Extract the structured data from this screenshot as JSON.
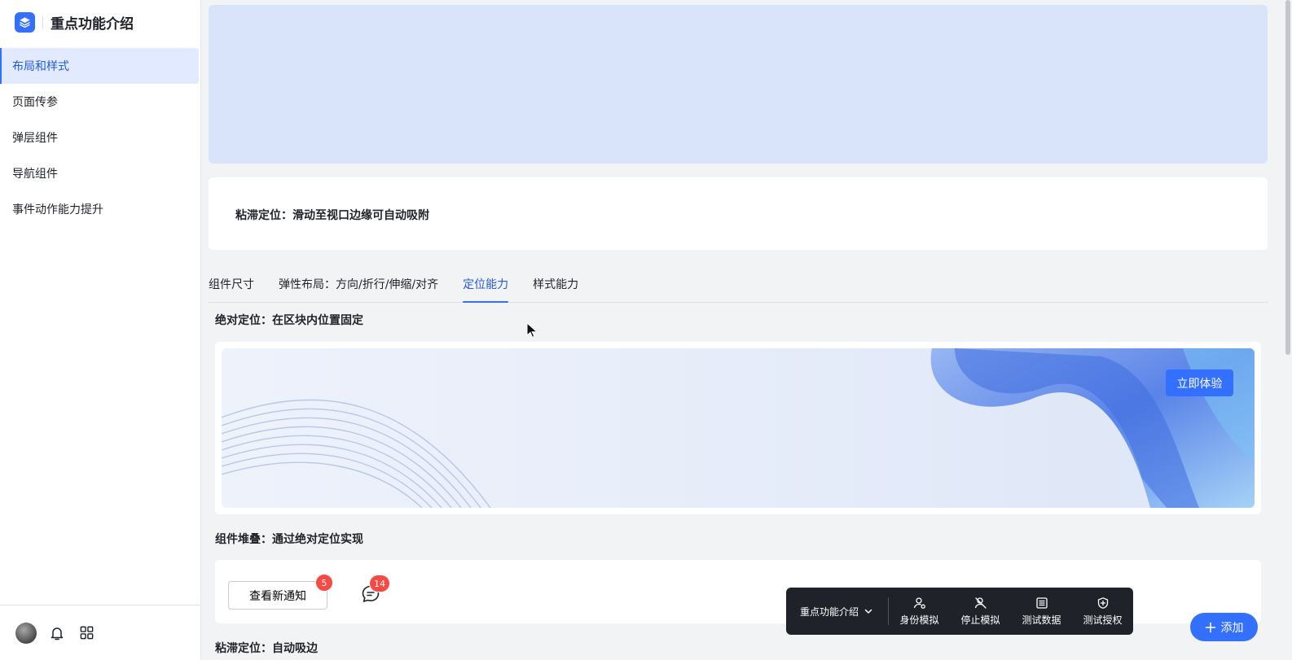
{
  "sidebar": {
    "brand_title": "重点功能介绍",
    "items": [
      {
        "label": "布局和样式",
        "active": true
      },
      {
        "label": "页面传参"
      },
      {
        "label": "弹层组件"
      },
      {
        "label": "导航组件"
      },
      {
        "label": "事件动作能力提升"
      }
    ]
  },
  "main": {
    "sticky_card_text": "粘滞定位：滑动至视口边缘可自动吸附",
    "tabs": [
      "组件尺寸",
      "弹性布局：方向/折行/伸缩/对齐",
      "定位能力",
      "样式能力"
    ],
    "active_tab_index": 2,
    "section_absolute": "绝对定位：在区块内位置固定",
    "try_button": "立即体验",
    "section_stack": "组件堆叠：通过绝对定位实现",
    "notify_button": "查看新通知",
    "notify_badge": "5",
    "chat_badge": "14",
    "section_sticky_edge": "粘滞定位：自动吸边"
  },
  "float_bar": {
    "select_label": "重点功能介绍",
    "items": [
      {
        "label": "身份模拟",
        "icon": "user-cog-icon"
      },
      {
        "label": "停止模拟",
        "icon": "user-off-icon"
      },
      {
        "label": "测试数据",
        "icon": "table-icon"
      },
      {
        "label": "测试授权",
        "icon": "shield-icon"
      }
    ]
  },
  "add_button": "添加",
  "colors": {
    "accent": "#3370ff",
    "active_text": "#245bdb",
    "badge": "#f54a45",
    "toolbar_bg": "#1f2329"
  }
}
